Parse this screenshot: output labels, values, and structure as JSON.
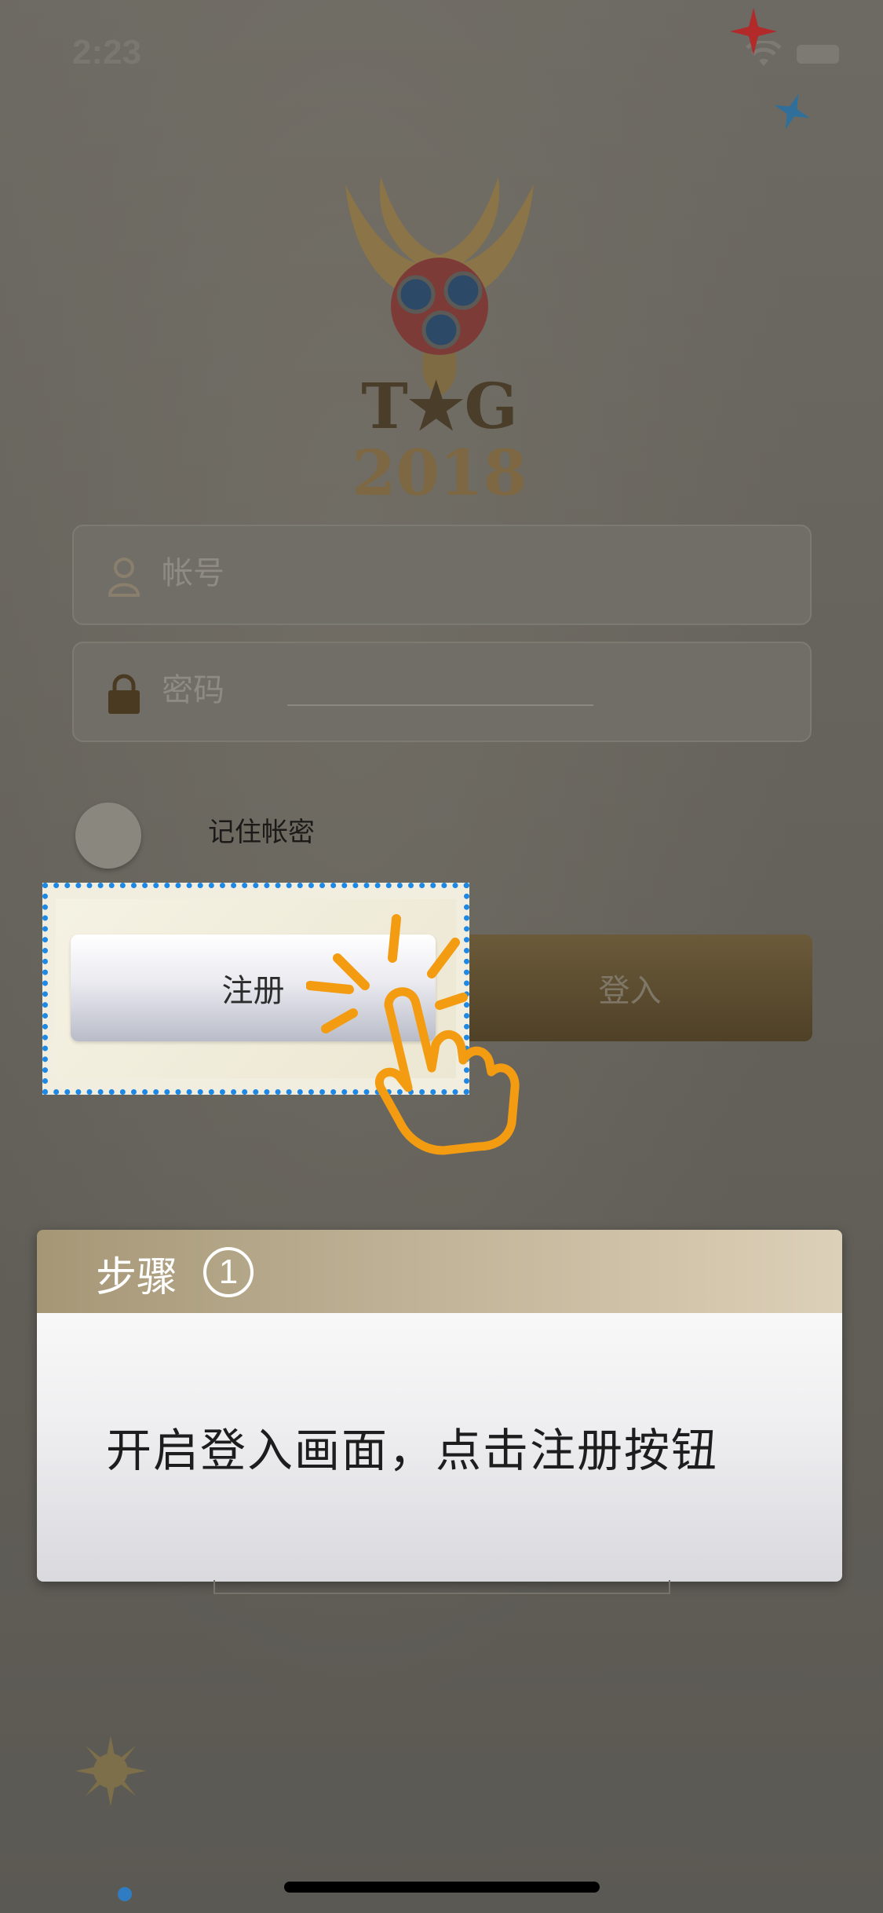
{
  "status_bar": {
    "time": "2:23"
  },
  "logo": {
    "title": "T★G",
    "year": "2018"
  },
  "login_form": {
    "account_placeholder": "帐号",
    "password_placeholder": "密码",
    "remember_label": "记住帐密",
    "register_label": "注册",
    "login_label": "登入"
  },
  "step_card": {
    "title": "步骤",
    "number": "1",
    "instruction": "开启登入画面，点击注册按钮"
  },
  "colors": {
    "highlight_border": "#1e88e5",
    "tap_hand": "#f39c12",
    "star_red": "#c0392b",
    "star_blue": "#2980b9"
  },
  "icons": [
    "user-icon",
    "lock-icon",
    "tap-hand-icon",
    "wifi-icon",
    "battery-icon"
  ]
}
